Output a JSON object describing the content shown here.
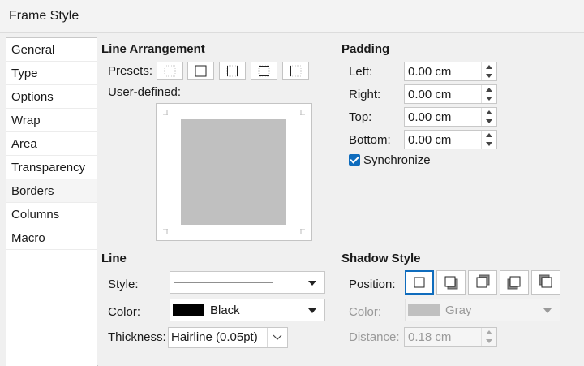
{
  "window": {
    "title": "Frame Style"
  },
  "sidebar": {
    "items": [
      {
        "label": "General"
      },
      {
        "label": "Type"
      },
      {
        "label": "Options"
      },
      {
        "label": "Wrap"
      },
      {
        "label": "Area"
      },
      {
        "label": "Transparency"
      },
      {
        "label": "Borders",
        "active": true
      },
      {
        "label": "Columns"
      },
      {
        "label": "Macro"
      }
    ]
  },
  "line_arrangement": {
    "title": "Line Arrangement",
    "presets_label": "Presets:",
    "user_defined_label": "User-defined:",
    "preset_icons": [
      "border-none-icon",
      "border-all-icon",
      "border-left-right-icon",
      "border-top-bottom-icon",
      "border-left-icon"
    ]
  },
  "padding": {
    "title": "Padding",
    "left": {
      "label": "Left:",
      "value": "0.00 cm"
    },
    "right": {
      "label": "Right:",
      "value": "0.00 cm"
    },
    "top": {
      "label": "Top:",
      "value": "0.00 cm"
    },
    "bottom": {
      "label": "Bottom:",
      "value": "0.00 cm"
    },
    "synchronize": {
      "label": "Synchronize",
      "checked": true
    }
  },
  "line": {
    "title": "Line",
    "style_label": "Style:",
    "color_label": "Color:",
    "color_value": "Black",
    "color_hex": "#000000",
    "thickness_label": "Thickness:",
    "thickness_value": "Hairline (0.05pt)"
  },
  "shadow_style": {
    "title": "Shadow Style",
    "position_label": "Position:",
    "position_icons": [
      "no-shadow-icon",
      "shadow-bottom-right-icon",
      "shadow-top-right-icon",
      "shadow-bottom-left-icon",
      "shadow-top-left-icon"
    ],
    "color_label": "Color:",
    "color_value": "Gray",
    "color_hex": "#c0c0c0",
    "distance_label": "Distance:",
    "distance_value": "0.18 cm"
  },
  "colors": {
    "accent": "#0f6cbd"
  }
}
